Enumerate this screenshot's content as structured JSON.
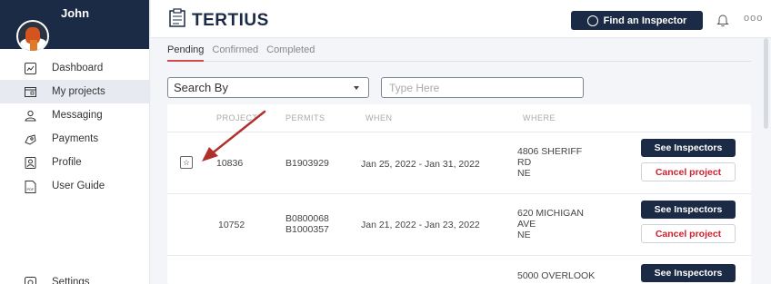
{
  "sidebar": {
    "user_name": "John",
    "items": [
      {
        "label": "Dashboard",
        "icon": "dashboard-icon"
      },
      {
        "label": "My projects",
        "icon": "projects-icon"
      },
      {
        "label": "Messaging",
        "icon": "messaging-icon"
      },
      {
        "label": "Payments",
        "icon": "payments-icon"
      },
      {
        "label": "Profile",
        "icon": "profile-icon"
      },
      {
        "label": "User Guide",
        "icon": "pdf-icon"
      }
    ],
    "settings_label": "Settings",
    "active_item": "My projects"
  },
  "header": {
    "logo_text": "TERTIUS",
    "find_button_label": "Find an Inspector",
    "more_label": "ooo"
  },
  "tabs": [
    {
      "label": "Pending",
      "active": true
    },
    {
      "label": "Confirmed",
      "active": false
    },
    {
      "label": "Completed",
      "active": false
    }
  ],
  "search": {
    "by_label": "Search By",
    "placeholder": "Type Here"
  },
  "table": {
    "columns": [
      "PROJECT",
      "PERMITS",
      "WHEN",
      "WHERE"
    ],
    "rows": [
      {
        "project": "10836",
        "permits": [
          "B1903929"
        ],
        "when": "Jan 25, 2022 - Jan 31, 2022",
        "where": [
          "4806 SHERIFF",
          "RD",
          "NE"
        ],
        "see_label": "See Inspectors",
        "cancel_label": "Cancel project"
      },
      {
        "project": "10752",
        "permits": [
          "B0800068",
          "B1000357"
        ],
        "when": "Jan 21, 2022 - Jan 23, 2022",
        "where": [
          "620 MICHIGAN",
          "AVE",
          "NE"
        ],
        "see_label": "See Inspectors",
        "cancel_label": "Cancel project"
      },
      {
        "where": [
          "5000 OVERLOOK"
        ],
        "see_label": "See Inspectors"
      }
    ]
  },
  "colors": {
    "navy": "#1b2b45",
    "cancel_red": "#d11f2e",
    "tab_underline": "#d14b4b",
    "annotation_arrow": "#b0312b"
  }
}
